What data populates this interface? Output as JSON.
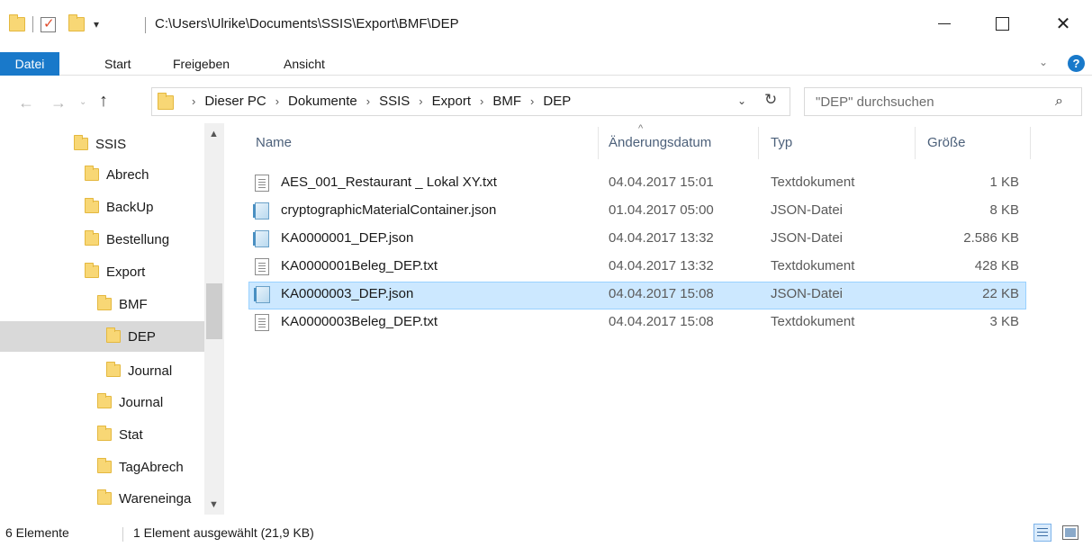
{
  "window": {
    "title_path": "C:\\Users\\Ulrike\\Documents\\SSIS\\Export\\BMF\\DEP",
    "quick_access_dropdown": "▾",
    "minimize_glyph": "",
    "close_glyph": "✕"
  },
  "ribbon": {
    "tabs": [
      "Datei",
      "Start",
      "Freigeben",
      "Ansicht"
    ],
    "active_color": "#1979ca",
    "help_glyph": "?"
  },
  "address": {
    "back": "←",
    "forward": "→",
    "recent": "⌄",
    "up": "↑",
    "breadcrumbs": [
      "Dieser PC",
      "Dokumente",
      "SSIS",
      "Export",
      "BMF",
      "DEP"
    ],
    "crumb_separator": "›",
    "refresh": "↻",
    "dropdown": "⌄"
  },
  "search": {
    "placeholder": "\"DEP\" durchsuchen",
    "icon": "⌕"
  },
  "tree": [
    {
      "label": "SSIS"
    },
    {
      "label": "Abrech"
    },
    {
      "label": "BackUp"
    },
    {
      "label": "Bestellung"
    },
    {
      "label": "Export"
    },
    {
      "label": "BMF"
    },
    {
      "label": "DEP",
      "selected": true
    },
    {
      "label": "Journal"
    },
    {
      "label": "Journal"
    },
    {
      "label": "Stat"
    },
    {
      "label": "TagAbrech"
    },
    {
      "label": "Wareneinga"
    }
  ],
  "list": {
    "columns": {
      "name": "Name",
      "date": "Änderungsdatum",
      "type": "Typ",
      "size": "Größe"
    },
    "sort_caret": "^",
    "files": [
      {
        "name": "AES_001_Restaurant _ Lokal XY.txt",
        "date": "04.04.2017 15:01",
        "type": "Textdokument",
        "size": "1 KB",
        "icon": "text-file-icon"
      },
      {
        "name": "cryptographicMaterialContainer.json",
        "date": "01.04.2017 05:00",
        "type": "JSON-Datei",
        "size": "8 KB",
        "icon": "json-file-icon"
      },
      {
        "name": "KA0000001_DEP.json",
        "date": "04.04.2017 13:32",
        "type": "JSON-Datei",
        "size": "2.586 KB",
        "icon": "json-file-icon"
      },
      {
        "name": "KA0000001Beleg_DEP.txt",
        "date": "04.04.2017 13:32",
        "type": "Textdokument",
        "size": "428 KB",
        "icon": "text-file-icon"
      },
      {
        "name": "KA0000003_DEP.json",
        "date": "04.04.2017 15:08",
        "type": "JSON-Datei",
        "size": "22 KB",
        "icon": "json-file-icon",
        "selected": true
      },
      {
        "name": "KA0000003Beleg_DEP.txt",
        "date": "04.04.2017 15:08",
        "type": "Textdokument",
        "size": "3 KB",
        "icon": "text-file-icon"
      }
    ]
  },
  "status": {
    "count": "6 Elemente",
    "selection": "1 Element ausgewählt (21,9 KB)"
  }
}
